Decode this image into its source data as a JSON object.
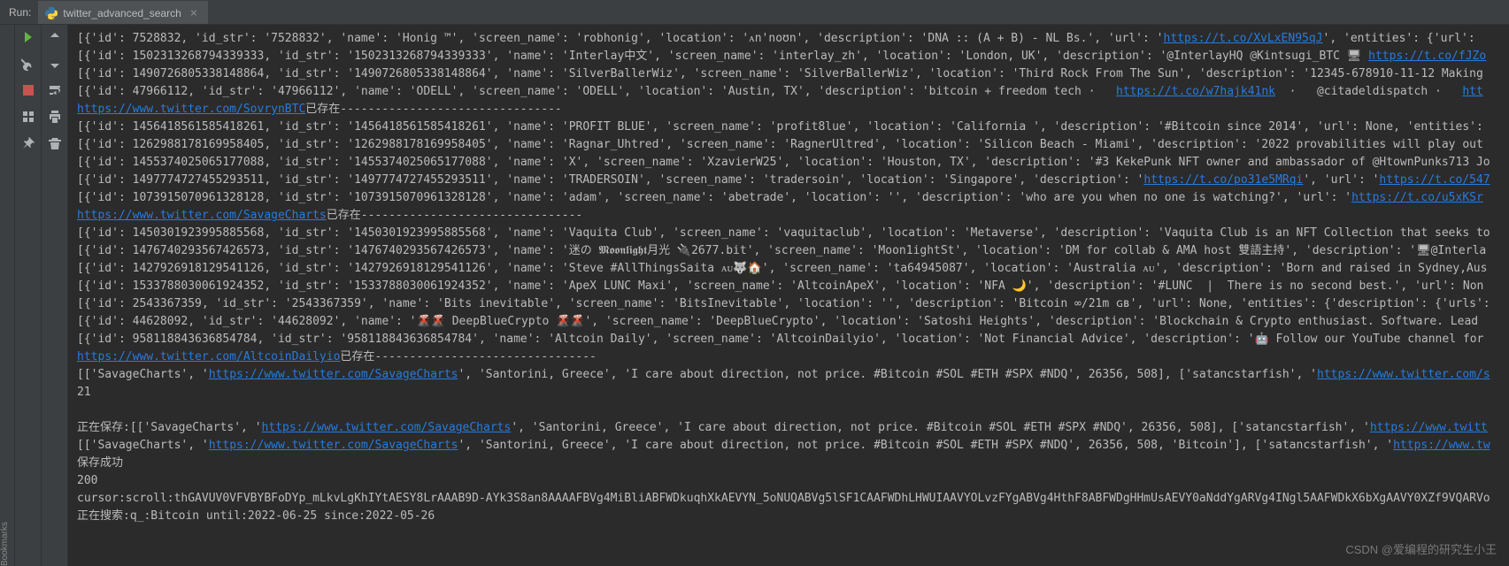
{
  "header": {
    "run_label": "Run:",
    "tab_name": "twitter_advanced_search"
  },
  "watermark": "CSDN @爱编程的研究生小王",
  "sidebar_label": "Bookmarks",
  "console": {
    "r1_a": "[{'id': 7528832, 'id_str': '7528832', 'name': 'Honig ™', 'screen_name': 'robhonig', 'location': 'ᴀn'noʊn', 'description': 'DNA :: (A + B) - NL Bs.', 'url': '",
    "r1_url": "https://t.co/XvLxEN95qJ",
    "r1_b": "', 'entities': {'url':",
    "r2_a": "[{'id': 1502313268794339333, 'id_str': '1502313268794339333', 'name': 'Interlay中文', 'screen_name': 'interlay_zh', 'location': 'London, UK', 'description': '@InterlayHQ @Kintsugi_BTC 🖥 ",
    "r2_url": "https://t.co/fJZo",
    "r3": "[{'id': 1490726805338148864, 'id_str': '1490726805338148864', 'name': 'SilverBallerWiz', 'screen_name': 'SilverBallerWiz', 'location': 'Third Rock From The Sun', 'description': '12345-678910-11-12 Making",
    "r4_a": "[{'id': 47966112, 'id_str': '47966112', 'name': 'ODELL', 'screen_name': 'ODELL', 'location': 'Austin, TX', 'description': 'bitcoin + freedom tech ·   ",
    "r4_url1": "https://t.co/w7hajk41nk",
    "r4_b": "  ·   @citadeldispatch ·   ",
    "r4_url2": "htt",
    "r5_url": "https://www.twitter.com/SovrynBTC",
    "r5_b": "已存在--------------------------------",
    "r6": "[{'id': 1456418561585418261, 'id_str': '1456418561585418261', 'name': 'PROFIT BLUE', 'screen_name': 'profit8lue', 'location': 'California ', 'description': '#Bitcoin since 2014', 'url': None, 'entities':",
    "r7": "[{'id': 1262988178169958405, 'id_str': '1262988178169958405', 'name': 'Ragnar_Uhtred', 'screen_name': 'RagnerUltred', 'location': 'Silicon Beach - Miami', 'description': '2022 provabilities will play out",
    "r8": "[{'id': 1455374025065177088, 'id_str': '1455374025065177088', 'name': 'X', 'screen_name': 'XzavierW25', 'location': 'Houston, TX', 'description': '#3 KekePunk NFT owner and ambassador of @HtownPunks713 Jo",
    "r9_a": "[{'id': 1497774727455293511, 'id_str': '1497774727455293511', 'name': 'TRADERSOIN', 'screen_name': 'tradersoin', 'location': 'Singapore', 'description': '",
    "r9_url1": "https://t.co/po31e5MRqi",
    "r9_b": "', 'url': '",
    "r9_url2": "https://t.co/547",
    "r10_a": "[{'id': 1073915070961328128, 'id_str': '1073915070961328128', 'name': 'adam', 'screen_name': 'abetrade', 'location': '', 'description': 'who are you when no one is watching?', 'url': '",
    "r10_url": "https://t.co/u5xKSr",
    "r11_url": "https://www.twitter.com/SavageCharts",
    "r11_b": "已存在--------------------------------",
    "r12": "[{'id': 1450301923995885568, 'id_str': '1450301923995885568', 'name': 'Vaquita Club', 'screen_name': 'vaquitaclub', 'location': 'Metaverse', 'description': 'Vaquita Club is an NFT Collection that seeks to",
    "r13": "[{'id': 1476740293567426573, 'id_str': '1476740293567426573', 'name': '迷の 𝕸𝖔𝖔𝖓𝖑𝖎𝖌𝖍𝖙月光 🔌2677.bit', 'screen_name': 'Moon1ightSt', 'location': 'DM for collab & AMA host 雙語主持', 'description': '🖥@Interla",
    "r14": "[{'id': 1427926918129541126, 'id_str': '1427926918129541126', 'name': 'Steve #AllThingsSaita ᴀᴜ🐺🏠', 'screen_name': 'ta64945087', 'location': 'Australia ᴀᴜ', 'description': 'Born and raised in Sydney,Aus",
    "r15": "[{'id': 1533788030061924352, 'id_str': '1533788030061924352', 'name': 'ApeX LUNC Maxi', 'screen_name': 'AltcoinApeX', 'location': 'NFA 🌙', 'description': '#LUNC  |  There is no second best.', 'url': Non",
    "r16": "[{'id': 2543367359, 'id_str': '2543367359', 'name': 'Bits inevitable', 'screen_name': 'BitsInevitable', 'location': '', 'description': 'Bitcoin ∞/21m ɢʙ', 'url': None, 'entities': {'description': {'urls':",
    "r17": "[{'id': 44628092, 'id_str': '44628092', 'name': '🌋🌋 DeepBlueCrypto 🌋🌋', 'screen_name': 'DeepBlueCrypto', 'location': 'Satoshi Heights', 'description': 'Blockchain & Crypto enthusiast. Software. Lead",
    "r18": "[{'id': 958118843636854784, 'id_str': '958118843636854784', 'name': 'Altcoin Daily', 'screen_name': 'AltcoinDailyio', 'location': 'Not Financial Advice', 'description': '🤖 Follow our YouTube channel for",
    "r19_url": "https://www.twitter.com/AltcoinDailyio",
    "r19_b": "已存在--------------------------------",
    "r20_a": "[['SavageCharts', '",
    "r20_url": "https://www.twitter.com/SavageCharts",
    "r20_b": "', 'Santorini, Greece', 'I care about direction, not price. #Bitcoin #SOL #ETH #SPX #NDQ', 26356, 508], ['satancstarfish', '",
    "r20_url2": "https://www.twitter.com/s",
    "r21": "21",
    "r22_a": "正在保存:[['SavageCharts', '",
    "r22_url": "https://www.twitter.com/SavageCharts",
    "r22_b": "', 'Santorini, Greece', 'I care about direction, not price. #Bitcoin #SOL #ETH #SPX #NDQ', 26356, 508], ['satancstarfish', '",
    "r22_url2": "https://www.twitt",
    "r23_a": "[['SavageCharts', '",
    "r23_url": "https://www.twitter.com/SavageCharts",
    "r23_b": "', 'Santorini, Greece', 'I care about direction, not price. #Bitcoin #SOL #ETH #SPX #NDQ', 26356, 508, 'Bitcoin'], ['satancstarfish', '",
    "r23_url2": "https://www.tw",
    "r24": "保存成功",
    "r25": "200",
    "r26": "cursor:scroll:thGAVUV0VFVBYBFoDYp_mLkvLgKhIYtAESY8LrAAAB9D-AYk3S8an8AAAAFBVg4MiBliABFWDkuqhXkAEVYN_5oNUQABVg5lSF1CAAFWDhLHWUIAAVYOLvzFYgABVg4HthF8ABFWDgHHmUsAEVY0aNddYgARVg4INgl5AAFWDkX6bXgAAVY0XZf9VQARVo",
    "r27": "正在搜索:q_:Bitcoin until:2022-06-25 since:2022-05-26"
  }
}
